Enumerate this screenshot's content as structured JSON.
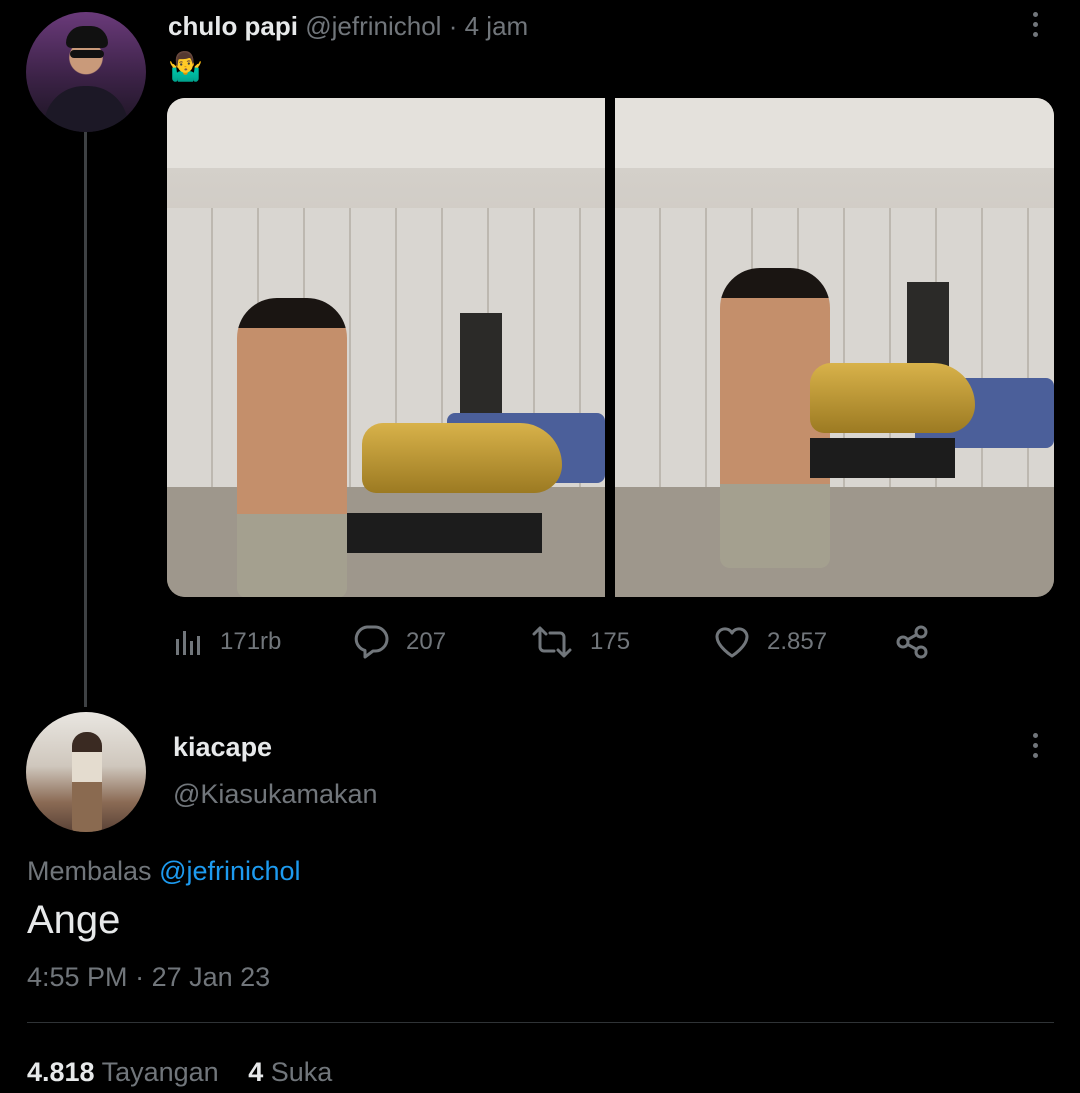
{
  "tweet": {
    "display_name": "chulo papi",
    "handle": "@jefrinichol",
    "separator": "·",
    "time_ago": "4 jam",
    "emoji": "🤷‍♂️",
    "more_icon": "more-vertical-icon",
    "actions": {
      "views": {
        "icon": "views-chart-icon",
        "count": "171rb"
      },
      "replies": {
        "icon": "reply-bubble-icon",
        "count": "207"
      },
      "retweets": {
        "icon": "retweet-icon",
        "count": "175"
      },
      "likes": {
        "icon": "heart-icon",
        "count": "2.857"
      },
      "share": {
        "icon": "share-icon"
      }
    }
  },
  "reply": {
    "display_name": "kiacape",
    "handle": "@Kiasukamakan",
    "replying_prefix": "Membalas",
    "replying_to": "@jefrinichol",
    "text": "Ange",
    "time": "4:55 PM",
    "separator": "·",
    "date": "27 Jan 23",
    "views_count": "4.818",
    "views_label": "Tayangan",
    "likes_count": "4",
    "likes_label": "Suka"
  },
  "colors": {
    "background": "#000000",
    "text_primary": "#e7e9ea",
    "text_muted": "#71767b",
    "link": "#1d9bf0",
    "divider": "#2f3336"
  }
}
